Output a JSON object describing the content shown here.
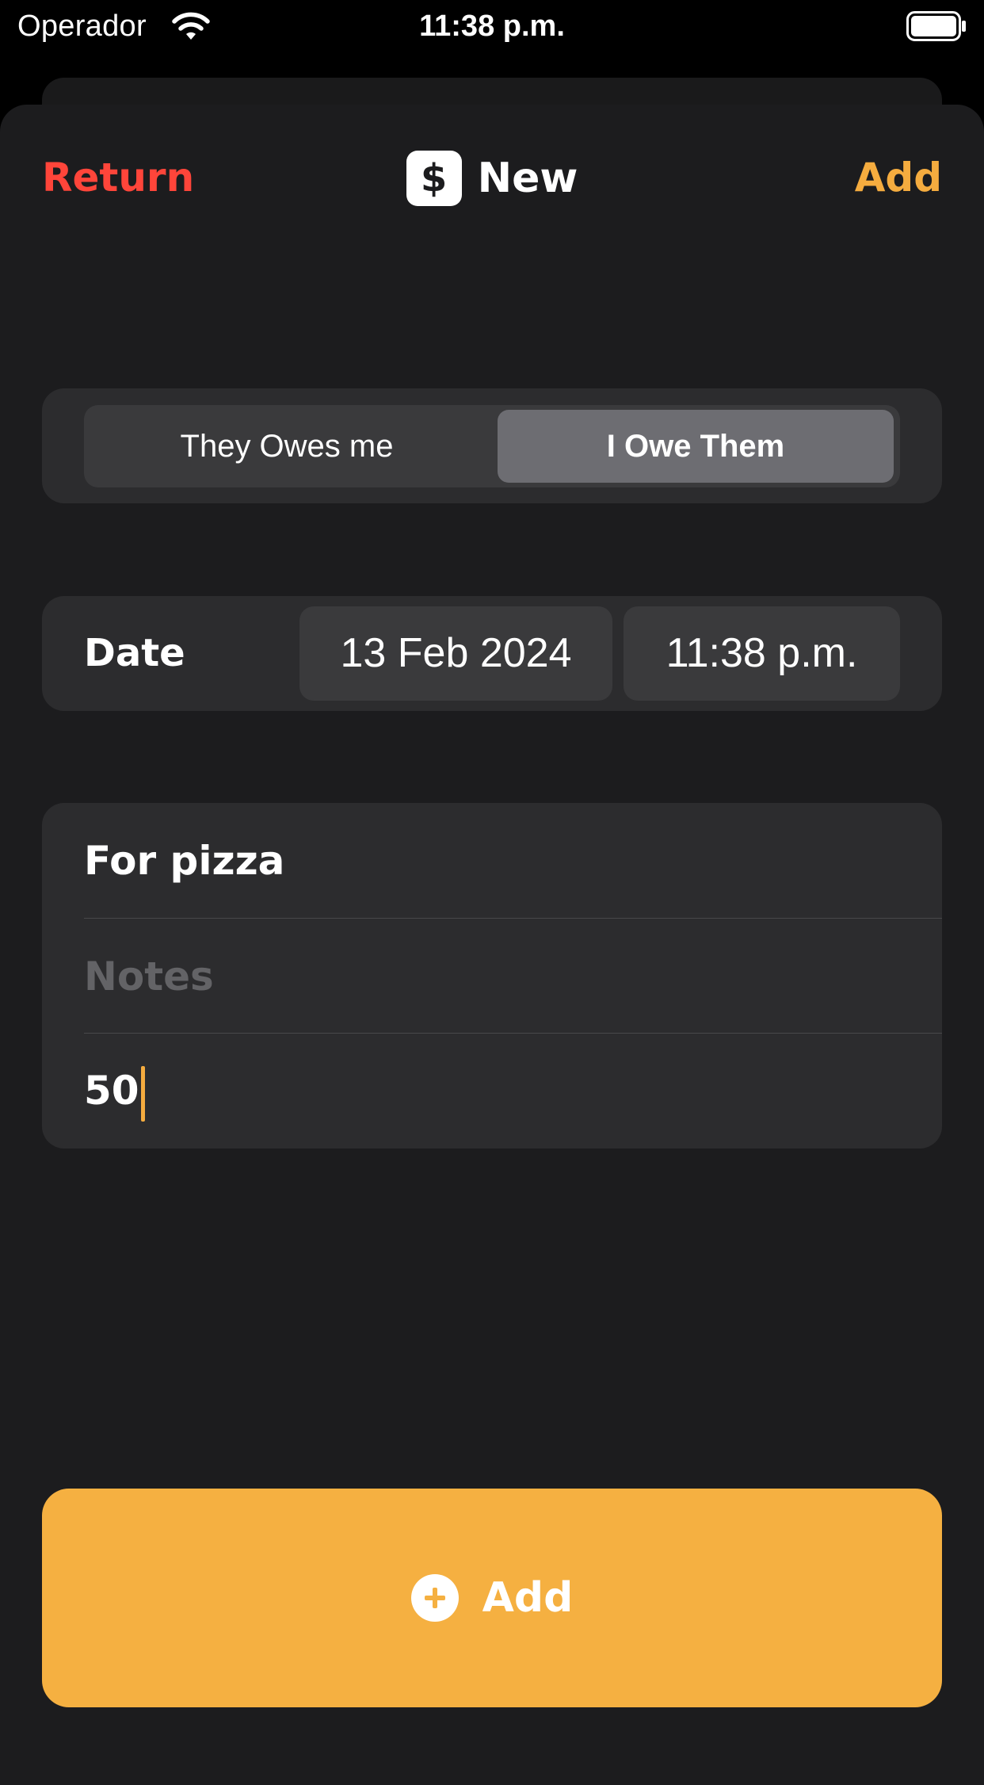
{
  "status_bar": {
    "carrier": "Operador",
    "time": "11:38 p.m."
  },
  "nav": {
    "return_label": "Return",
    "title": "New",
    "title_icon": "dollar-icon",
    "add_label": "Add"
  },
  "segmented": {
    "options": [
      "They Owes me",
      "I Owe Them"
    ],
    "selected_index": 1
  },
  "date_row": {
    "label": "Date",
    "date": "13 Feb 2024",
    "time": "11:38 p.m."
  },
  "fields": {
    "title_value": "For pizza",
    "notes_placeholder": "Notes",
    "notes_value": "",
    "amount_value": "50"
  },
  "primary_button": {
    "label": "Add",
    "icon": "plus-circle-icon"
  },
  "colors": {
    "background": "#000000",
    "sheet": "#1c1c1e",
    "card": "#2c2c2e",
    "return": "#ff453a",
    "accent": "#f5ac3f",
    "button": "#f5b041"
  }
}
